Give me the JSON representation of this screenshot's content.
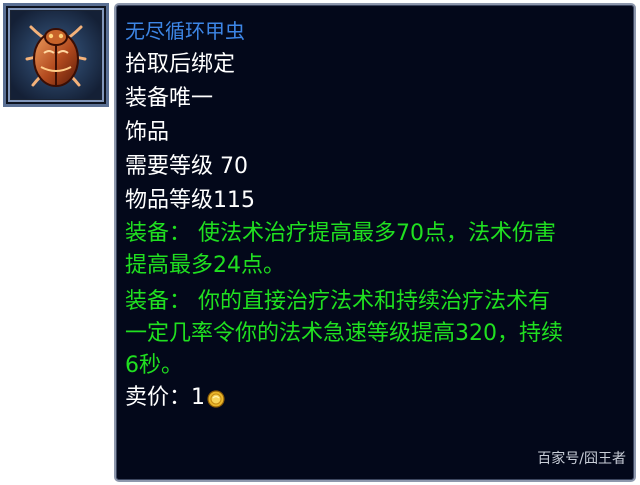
{
  "item": {
    "name": "无尽循环甲虫",
    "binding": "拾取后绑定",
    "unique": "装备唯一",
    "slot": "饰品",
    "required_level": "需要等级 70",
    "item_level": "物品等级115",
    "effects": [
      {
        "lines": [
          "装备： 使法术治疗提高最多70点，法术伤害",
          "提高最多24点。"
        ]
      },
      {
        "lines": [
          "装备： 你的直接治疗法术和持续治疗法术有",
          "一定几率令你的法术急速等级提高320，持续",
          "6秒。"
        ]
      }
    ],
    "sell_price": "卖价：1",
    "icon": "scarab-trinket-icon",
    "coin_icon": "gold-coin-icon"
  },
  "watermark": "百家号/囧王者",
  "colors": {
    "title": "#3d86e6",
    "effect": "#20e020",
    "text": "#ffffff",
    "background": "#03081a",
    "border": "#8e98ad"
  }
}
